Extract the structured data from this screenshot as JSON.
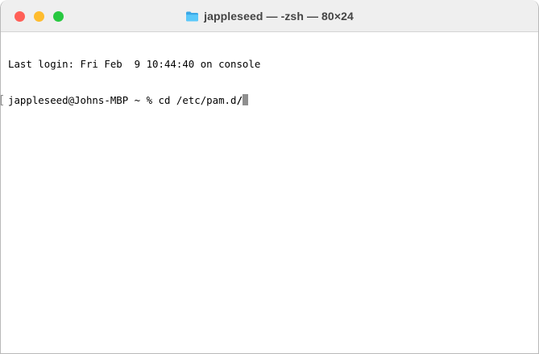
{
  "window": {
    "title": "jappleseed — -zsh — 80×24",
    "title_icon": "folder-icon",
    "traffic_lights": {
      "close_color": "#ff5f57",
      "minimize_color": "#febc2e",
      "zoom_color": "#28c840"
    },
    "folder_color": "#5ac8fa"
  },
  "terminal": {
    "lines": [
      "Last login: Fri Feb  9 10:44:40 on console"
    ],
    "prompt": "jappleseed@Johns-MBP ~ % ",
    "command_text": "cd /etc/pam.d",
    "command_trailing": "/",
    "cursor_color": "#8f8f8f"
  }
}
